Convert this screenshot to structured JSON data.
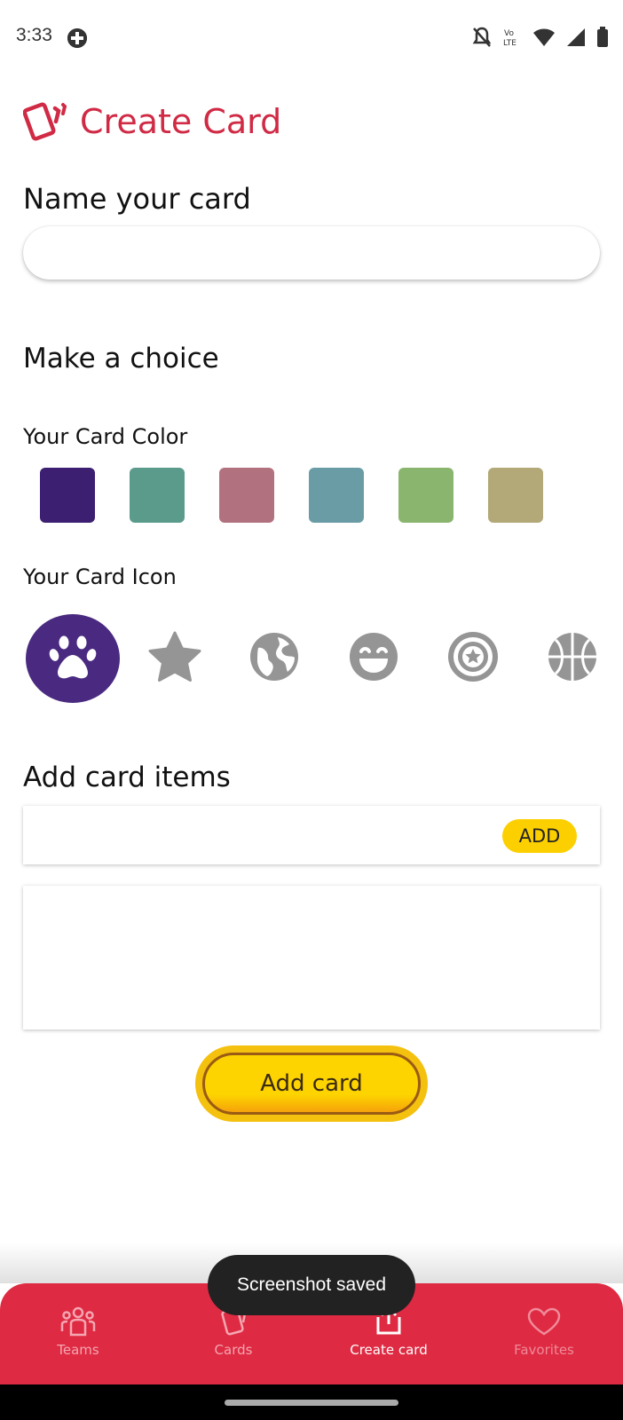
{
  "status_bar": {
    "time": "3:33",
    "icons": [
      "game-controller-icon",
      "notifications-off-icon",
      "volte-icon",
      "wifi-icon",
      "signal-icon",
      "battery-icon"
    ],
    "volte_text": "VoLTE"
  },
  "header": {
    "title": "Create Card",
    "icon": "cards-icon",
    "accent_color": "#d02a45"
  },
  "form": {
    "name_label": "Name your card",
    "name_value": "",
    "choice_label": "Make a choice",
    "color_label": "Your Card Color",
    "colors": [
      "#3d1f72",
      "#5a9b8c",
      "#b2717e",
      "#6a9ca6",
      "#8ab56e",
      "#b3a877"
    ],
    "icon_label": "Your Card Icon",
    "icons": [
      {
        "name": "paw-icon",
        "selected": true
      },
      {
        "name": "star-icon",
        "selected": false
      },
      {
        "name": "globe-icon",
        "selected": false
      },
      {
        "name": "smile-icon",
        "selected": false
      },
      {
        "name": "captain-shield-icon",
        "selected": false
      },
      {
        "name": "basketball-icon",
        "selected": false
      }
    ],
    "selected_icon_bg": "#4a2a80",
    "items_label": "Add card items",
    "item_value": "",
    "add_button_label": "ADD",
    "submit_label": "Add card"
  },
  "bottom_nav": {
    "items": [
      {
        "label": "Teams",
        "icon": "teams-icon"
      },
      {
        "label": "Cards",
        "icon": "cards-icon"
      },
      {
        "label": "Create card",
        "icon": "create-card-icon"
      },
      {
        "label": "Favorites",
        "icon": "heart-icon"
      }
    ],
    "active": "Create card",
    "bg_color": "#de2a42"
  },
  "toast": {
    "text": "Screenshot saved"
  }
}
